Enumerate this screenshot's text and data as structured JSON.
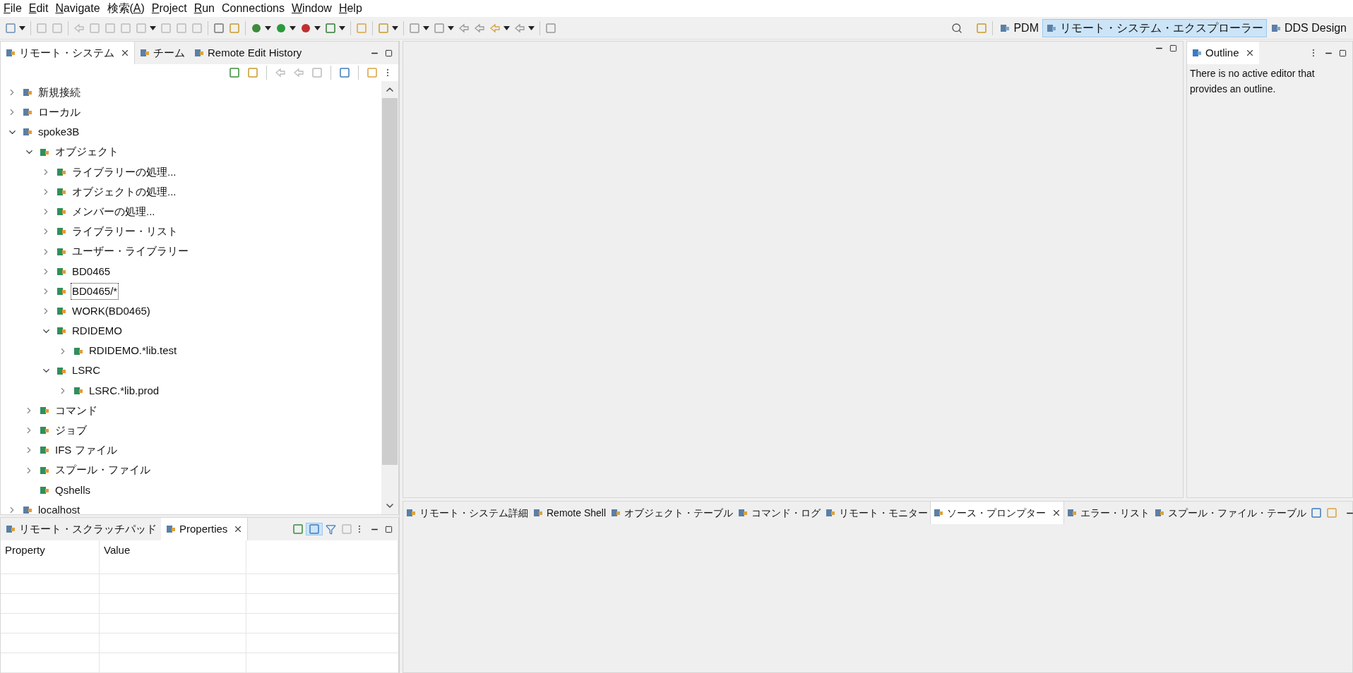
{
  "menu": [
    {
      "key": "F",
      "post": "ile"
    },
    {
      "key": "E",
      "post": "dit"
    },
    {
      "key": "N",
      "post": "avigate"
    },
    {
      "pre": "検索(",
      "key": "A",
      "post": ")"
    },
    {
      "key": "P",
      "post": "roject"
    },
    {
      "key": "R",
      "post": "un"
    },
    {
      "pre": "Connections"
    },
    {
      "key": "W",
      "post": "indow"
    },
    {
      "key": "H",
      "post": "elp"
    }
  ],
  "perspectives": [
    {
      "label": "PDM",
      "selected": false
    },
    {
      "label": "リモート・システム・エクスプローラー",
      "selected": true
    },
    {
      "label": "DDS Design",
      "selected": false
    }
  ],
  "left_view": {
    "tabs": [
      {
        "label": "リモート・システム",
        "selected": true
      },
      {
        "label": "チーム",
        "selected": false
      },
      {
        "label": "Remote Edit History",
        "selected": false
      }
    ],
    "tree": [
      {
        "label": "新規接続",
        "expanded": false
      },
      {
        "label": "ローカル",
        "expanded": false
      },
      {
        "label": "spoke3B",
        "expanded": true,
        "children": [
          {
            "label": "オブジェクト",
            "expanded": true,
            "children": [
              {
                "label": "ライブラリーの処理...",
                "expanded": false
              },
              {
                "label": "オブジェクトの処理...",
                "expanded": false
              },
              {
                "label": "メンバーの処理...",
                "expanded": false
              },
              {
                "label": "ライブラリー・リスト",
                "expanded": false
              },
              {
                "label": "ユーザー・ライブラリー",
                "expanded": false
              },
              {
                "label": "BD0465",
                "expanded": false
              },
              {
                "label": "BD0465/*",
                "expanded": false,
                "focused": true
              },
              {
                "label": "WORK(BD0465)",
                "expanded": false
              },
              {
                "label": "RDIDEMO",
                "expanded": true,
                "children": [
                  {
                    "label": "RDIDEMO.*lib.test",
                    "expanded": false
                  }
                ]
              },
              {
                "label": "LSRC",
                "expanded": true,
                "children": [
                  {
                    "label": "LSRC.*lib.prod",
                    "expanded": false
                  }
                ]
              }
            ]
          },
          {
            "label": "コマンド",
            "expanded": false
          },
          {
            "label": "ジョブ",
            "expanded": false
          },
          {
            "label": "IFS ファイル",
            "expanded": false
          },
          {
            "label": "スプール・ファイル",
            "expanded": false
          },
          {
            "label": "Qshells",
            "expandable": false
          }
        ]
      },
      {
        "label": "localhost",
        "expanded": false
      }
    ]
  },
  "properties_view": {
    "tabs": [
      {
        "label": "リモート・スクラッチパッド",
        "selected": false
      },
      {
        "label": "Properties",
        "selected": true
      }
    ],
    "columns": [
      "Property",
      "Value"
    ]
  },
  "outline": {
    "title": "Outline",
    "message": "There is no active editor that provides an outline."
  },
  "bottom_view": {
    "tabs": [
      {
        "label": "リモート・システム詳細",
        "selected": false
      },
      {
        "label": "Remote Shell",
        "selected": false
      },
      {
        "label": "オブジェクト・テーブル",
        "selected": false
      },
      {
        "label": "コマンド・ログ",
        "selected": false
      },
      {
        "label": "リモート・モニター",
        "selected": false
      },
      {
        "label": "ソース・プロンプター",
        "selected": true
      },
      {
        "label": "エラー・リスト",
        "selected": false
      },
      {
        "label": "スプール・ファイル・テーブル",
        "selected": false
      }
    ]
  }
}
